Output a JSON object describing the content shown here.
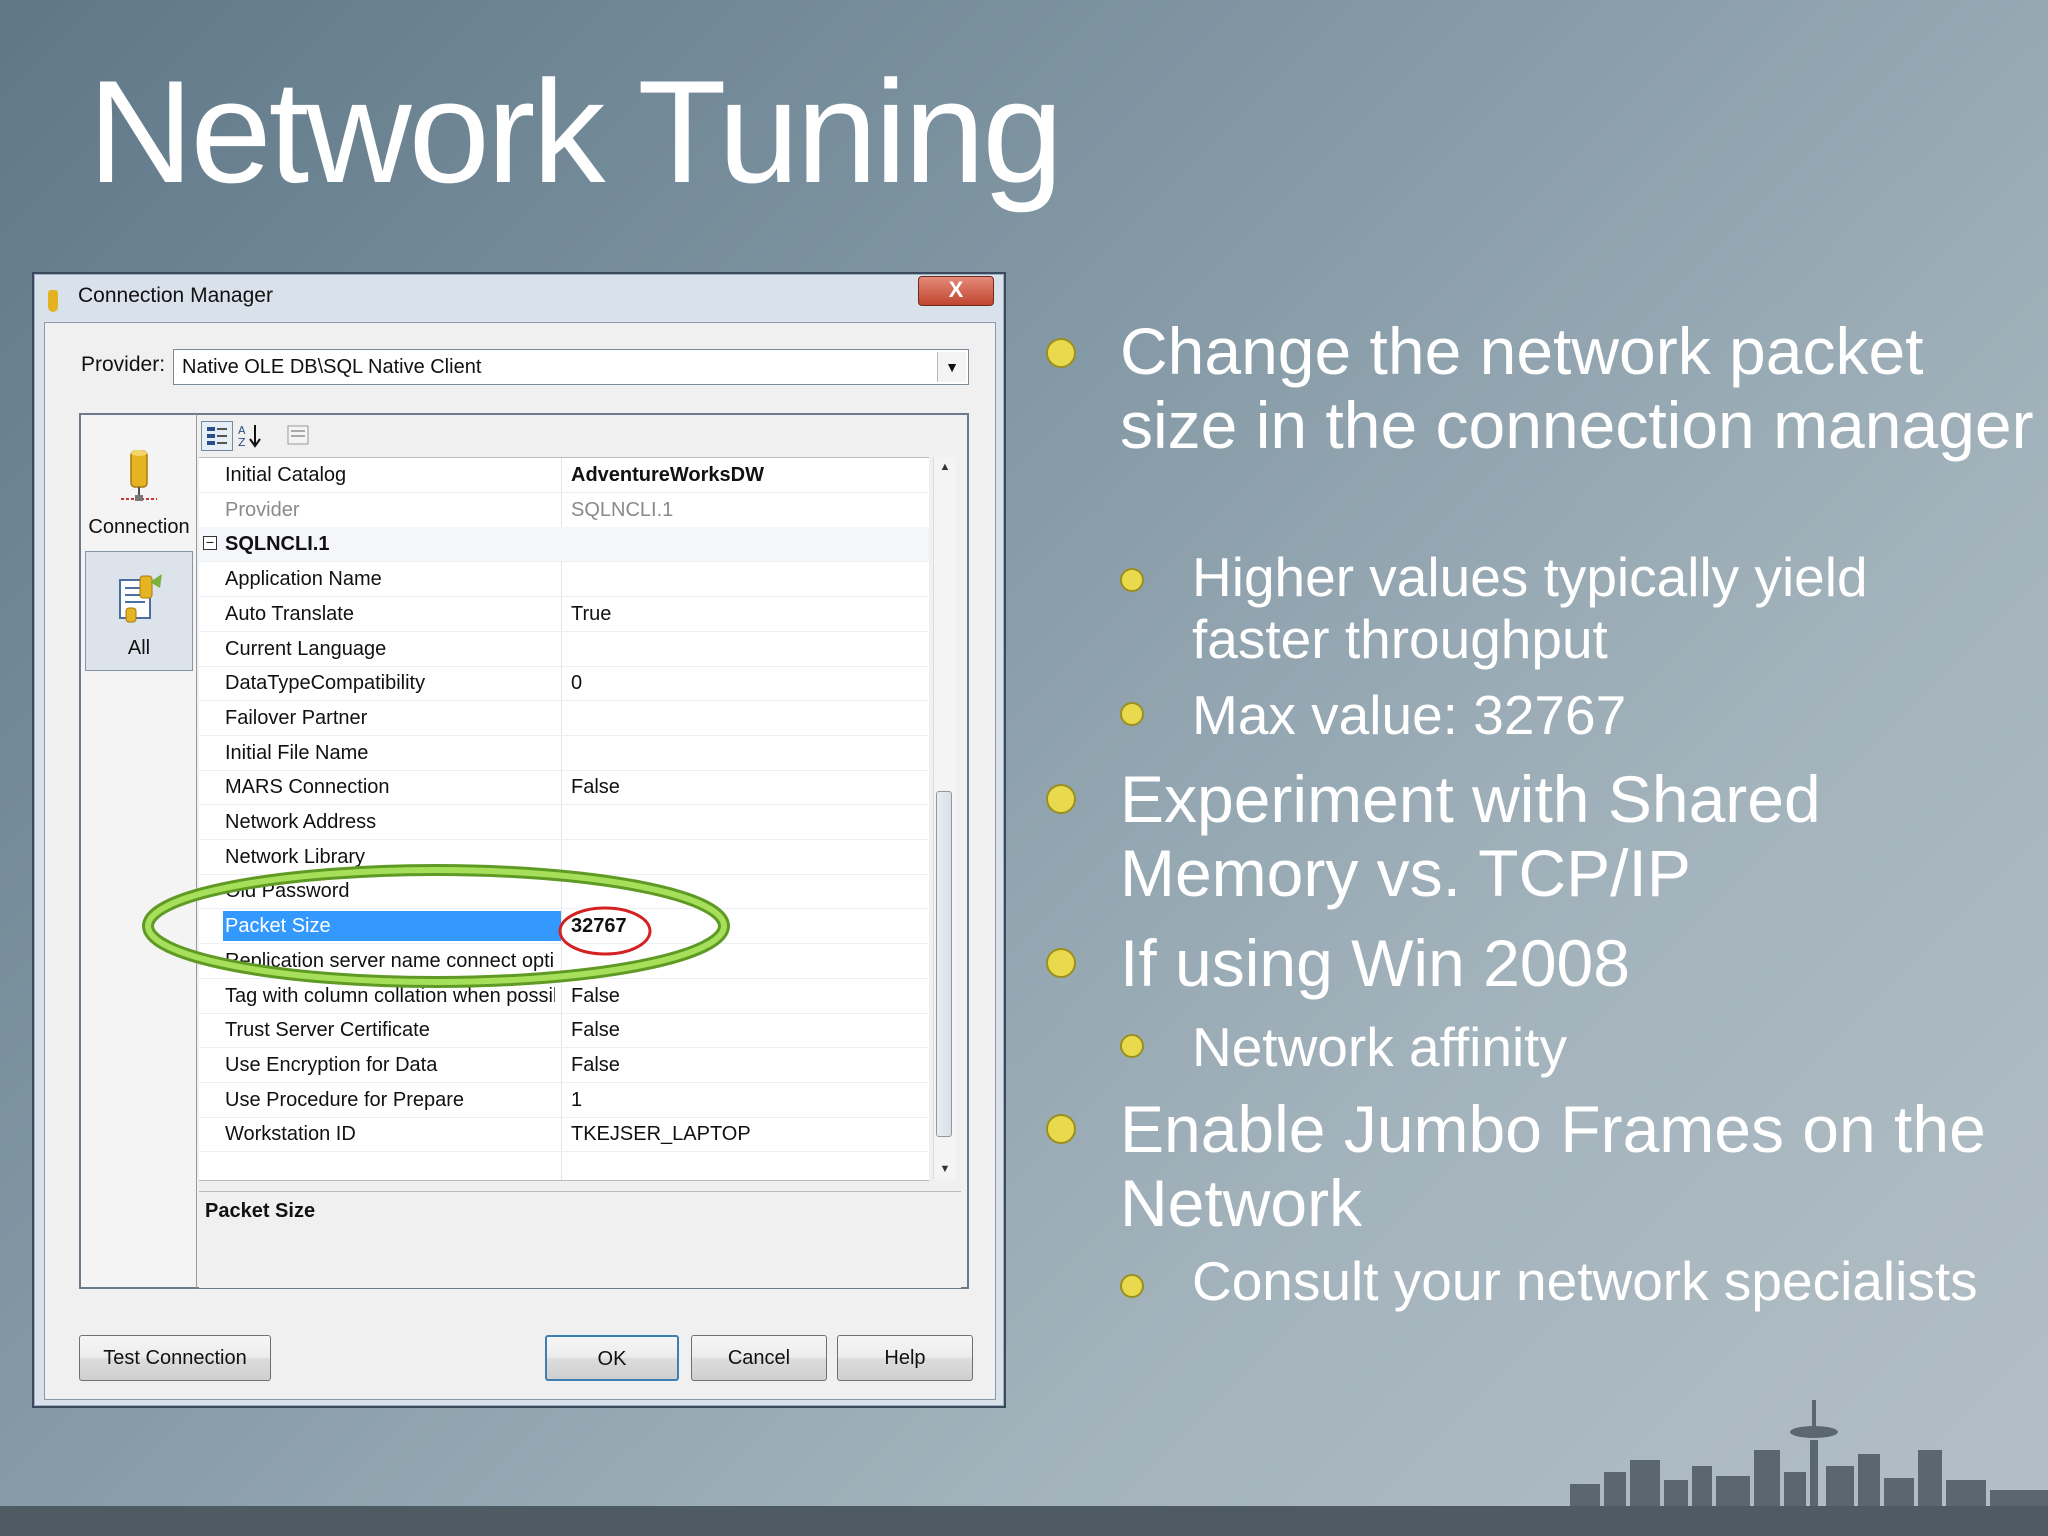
{
  "slide": {
    "title": "Network Tuning",
    "bullets": [
      {
        "text": "Change the network packet size in the connection manager",
        "level": 1
      },
      {
        "text": "Higher values typically yield faster throughput",
        "level": 2
      },
      {
        "text": "Max value: 32767",
        "level": 2
      },
      {
        "text": "Experiment with Shared Memory vs. TCP/IP",
        "level": 1
      },
      {
        "text": "If using Win 2008",
        "level": 1
      },
      {
        "text": "Network affinity",
        "level": 2
      },
      {
        "text": "Enable Jumbo Frames on the Network",
        "level": 1
      },
      {
        "text": "Consult your network specialists",
        "level": 2
      }
    ]
  },
  "dialog": {
    "title": "Connection Manager",
    "close_label": "X",
    "provider_label": "Provider:",
    "provider_value": "Native OLE DB\\SQL Native Client",
    "nav": {
      "connection_label": "Connection",
      "all_label": "All"
    },
    "properties": {
      "top_rows": [
        {
          "name": "Initial Catalog",
          "value": "AdventureWorksDW",
          "style": "bold"
        },
        {
          "name": "Provider",
          "value": "SQLNCLI.1",
          "style": "disabled"
        }
      ],
      "category": "SQLNCLI.1",
      "rows": [
        {
          "name": "Application Name",
          "value": ""
        },
        {
          "name": "Auto Translate",
          "value": "True"
        },
        {
          "name": "Current Language",
          "value": ""
        },
        {
          "name": "DataTypeCompatibility",
          "value": "0"
        },
        {
          "name": "Failover Partner",
          "value": ""
        },
        {
          "name": "Initial File Name",
          "value": ""
        },
        {
          "name": "MARS Connection",
          "value": "False"
        },
        {
          "name": "Network Address",
          "value": ""
        },
        {
          "name": "Network Library",
          "value": ""
        },
        {
          "name": "Old Password",
          "value": ""
        },
        {
          "name": "Packet Size",
          "value": "32767"
        },
        {
          "name": "Replication server name connect option",
          "value": ""
        },
        {
          "name": "Tag with column collation when possible",
          "value": "False"
        },
        {
          "name": "Trust Server Certificate",
          "value": "False"
        },
        {
          "name": "Use Encryption for Data",
          "value": "False"
        },
        {
          "name": "Use Procedure for Prepare",
          "value": "1"
        },
        {
          "name": "Workstation ID",
          "value": "TKEJSER_LAPTOP"
        }
      ],
      "selected": "Packet Size"
    },
    "description_title": "Packet Size",
    "buttons": {
      "test_connection": "Test Connection",
      "ok": "OK",
      "cancel": "Cancel",
      "help": "Help"
    }
  },
  "colors": {
    "selection": "#3399ff",
    "highlight_ring": "#8ccf3c",
    "value_circle": "#d42020",
    "bullet": "#e7d84a"
  }
}
